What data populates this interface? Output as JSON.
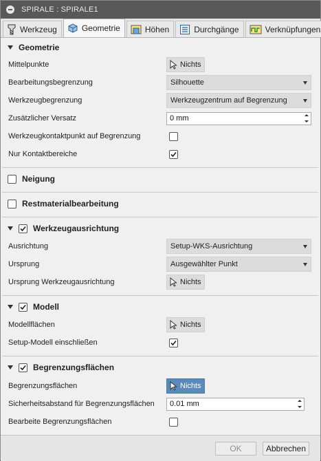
{
  "window": {
    "title": "SPIRALE : SPIRALE1"
  },
  "tabs": [
    {
      "label": "Werkzeug",
      "icon": "tool-icon"
    },
    {
      "label": "Geometrie",
      "icon": "geometry-cube-icon",
      "active": true
    },
    {
      "label": "Höhen",
      "icon": "heights-icon"
    },
    {
      "label": "Durchgänge",
      "icon": "passes-icon"
    },
    {
      "label": "Verknüpfungen",
      "icon": "linking-icon"
    }
  ],
  "geometrie": {
    "header": "Geometrie",
    "mittelpunkte": {
      "label": "Mittelpunkte",
      "button": "Nichts"
    },
    "bearbeitungsbegrenzung": {
      "label": "Bearbeitungsbegrenzung",
      "value": "Silhouette"
    },
    "werkzeugbegrenzung": {
      "label": "Werkzeugbegrenzung",
      "value": "Werkzeugzentrum auf Begrenzung"
    },
    "versatz": {
      "label": "Zusätzlicher Versatz",
      "value": "0 mm"
    },
    "kontaktpunkt": {
      "label": "Werkzeugkontaktpunkt auf Begrenzung",
      "checked": false
    },
    "kontaktbereiche": {
      "label": "Nur Kontaktbereiche",
      "checked": true
    }
  },
  "neigung": {
    "header": "Neigung",
    "checked": false
  },
  "restmaterial": {
    "header": "Restmaterialbearbeitung",
    "checked": false
  },
  "ausrichtung": {
    "header": "Werkzeugausrichtung",
    "checked": true,
    "ausrichtung": {
      "label": "Ausrichtung",
      "value": "Setup-WKS-Ausrichtung"
    },
    "ursprung": {
      "label": "Ursprung",
      "value": "Ausgewählter Punkt"
    },
    "ursprung_ausrichtung": {
      "label": "Ursprung Werkzeugausrichtung",
      "button": "Nichts"
    }
  },
  "modell": {
    "header": "Modell",
    "checked": true,
    "modellflaechen": {
      "label": "Modellflächen",
      "button": "Nichts"
    },
    "setup_modell": {
      "label": "Setup-Modell einschließen",
      "checked": true
    }
  },
  "begrenzungsflaechen": {
    "header": "Begrenzungsflächen",
    "checked": true,
    "flaechen": {
      "label": "Begrenzungsflächen",
      "button": "Nichts"
    },
    "sicherheitsabstand": {
      "label": "Sicherheitsabstand für Begrenzungsflächen",
      "value": "0.01 mm"
    },
    "bearbeite": {
      "label": "Bearbeite Begrenzungsflächen",
      "checked": false
    }
  },
  "footer": {
    "ok_label": "OK",
    "cancel_label": "Abbrechen"
  },
  "colors": {
    "titlebar": "#585858",
    "active_pick": "#5a8bb8",
    "panel": "#f0f0f0"
  }
}
